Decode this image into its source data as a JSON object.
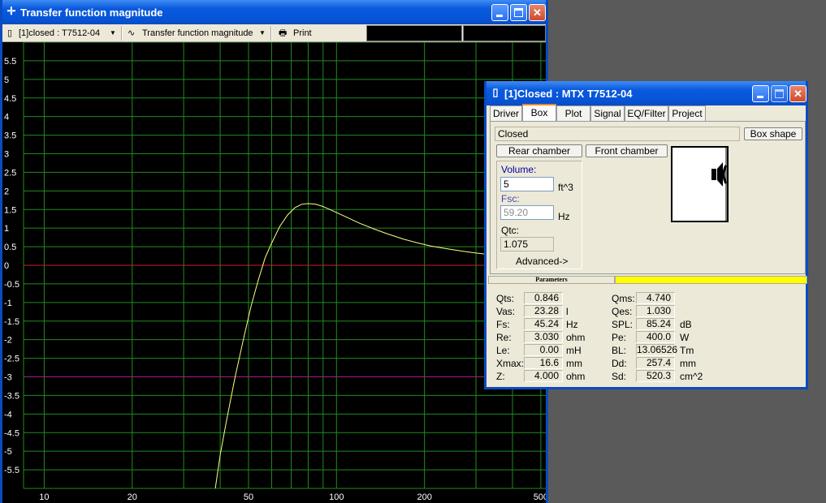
{
  "main_window": {
    "title": "Transfer function magnitude",
    "toolbar": {
      "project_select": "[1]closed : T7512-04",
      "view_select": "Transfer function magnitude",
      "print_label": "Print"
    }
  },
  "chart_data": {
    "type": "line",
    "x_scale": "log",
    "xlim": [
      8.5,
      520
    ],
    "ylim": [
      -6,
      6
    ],
    "x_tick_labels": [
      "10",
      "20",
      "50",
      "100",
      "200",
      "500"
    ],
    "x_ticks": [
      10,
      20,
      50,
      100,
      200,
      500
    ],
    "y_tick_labels": [
      "5.5",
      "5",
      "4.5",
      "4",
      "3.5",
      "3",
      "2.5",
      "2",
      "1.5",
      "1",
      "0.5",
      "0",
      "-0.5",
      "-1",
      "-1.5",
      "-2",
      "-2.5",
      "-3",
      "-3.5",
      "-4",
      "-4.5",
      "-5",
      "-5.5"
    ],
    "y_ticks": [
      5.5,
      5,
      4.5,
      4,
      3.5,
      3,
      2.5,
      2,
      1.5,
      1,
      0.5,
      0,
      -0.5,
      -1,
      -1.5,
      -2,
      -2.5,
      -3,
      -3.5,
      -4,
      -4.5,
      -5,
      -5.5
    ],
    "reference_lines": [
      {
        "y": 0,
        "color": "#d02020"
      },
      {
        "y": -3,
        "color": "#a0208a"
      }
    ],
    "grid": true,
    "series": [
      {
        "color": "#ffff80",
        "x": [
          38.5,
          40,
          42,
          45,
          48,
          51,
          54,
          57,
          60,
          64,
          68,
          72,
          76,
          80,
          85,
          90,
          95,
          100,
          110,
          120,
          135,
          150,
          170,
          190,
          210,
          240,
          270,
          300,
          350,
          400,
          450,
          500
        ],
        "y": [
          -6.0,
          -5.1,
          -4.2,
          -3.0,
          -2.0,
          -1.1,
          -0.4,
          0.2,
          0.6,
          1.05,
          1.35,
          1.55,
          1.64,
          1.66,
          1.64,
          1.58,
          1.5,
          1.42,
          1.27,
          1.13,
          0.97,
          0.84,
          0.7,
          0.6,
          0.52,
          0.44,
          0.38,
          0.33,
          0.27,
          0.23,
          0.2,
          0.18
        ]
      }
    ]
  },
  "dialog": {
    "title": "[1]Closed : MTX T7512-04",
    "tabs": [
      "Driver",
      "Box",
      "Plot",
      "Signal",
      "EQ/Filter",
      "Project"
    ],
    "active_tab": "Box",
    "box_type": "Closed",
    "box_shape_button": "Box shape",
    "rear_chamber_button": "Rear chamber",
    "front_chamber_button": "Front chamber",
    "volume_label": "Volume:",
    "volume_value": "5",
    "volume_unit": "ft^3",
    "fsc_label": "Fsc:",
    "fsc_value": "59.20",
    "fsc_unit": "Hz",
    "qtc_label": "Qtc:",
    "qtc_value": "1.075",
    "advanced_label": "Advanced->",
    "parameters_label": "Parameters",
    "params_left": [
      {
        "label": "Qts:",
        "value": "0.846",
        "unit": ""
      },
      {
        "label": "Vas:",
        "value": "23.28",
        "unit": "l"
      },
      {
        "label": "Fs:",
        "value": "45.24",
        "unit": "Hz"
      },
      {
        "label": "Re:",
        "value": "3.030",
        "unit": "ohm"
      },
      {
        "label": "Le:",
        "value": "0.00",
        "unit": "mH"
      },
      {
        "label": "Xmax:",
        "value": "16.6",
        "unit": "mm"
      },
      {
        "label": "Z:",
        "value": "4.000",
        "unit": "ohm"
      }
    ],
    "params_right": [
      {
        "label": "Qms:",
        "value": "4.740",
        "unit": ""
      },
      {
        "label": "Qes:",
        "value": "1.030",
        "unit": ""
      },
      {
        "label": "SPL:",
        "value": "85.24",
        "unit": "dB"
      },
      {
        "label": "Pe:",
        "value": "400.0",
        "unit": "W"
      },
      {
        "label": "BL:",
        "value": "13.06526",
        "unit": "Tm"
      },
      {
        "label": "Dd:",
        "value": "257.4",
        "unit": "mm"
      },
      {
        "label": "Sd:",
        "value": "520.3",
        "unit": "cm^2"
      }
    ]
  }
}
